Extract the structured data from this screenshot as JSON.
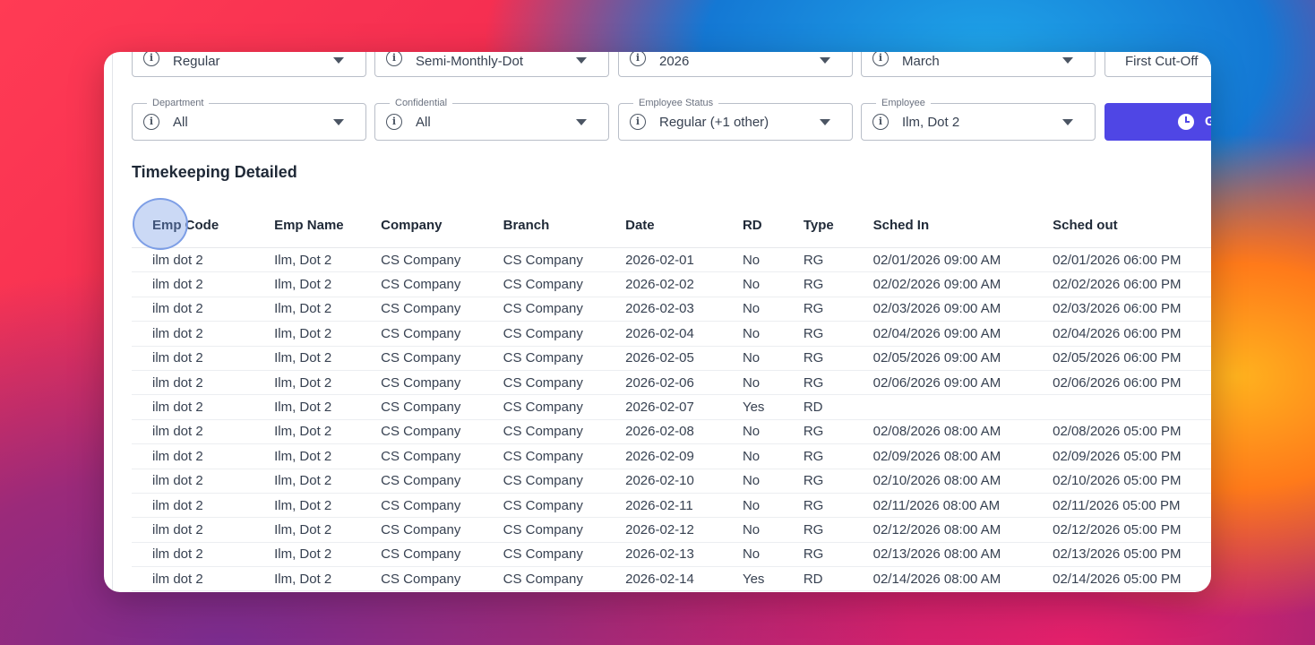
{
  "filters_row1": [
    {
      "value": "Regular"
    },
    {
      "value": "Semi-Monthly-Dot"
    },
    {
      "value": "2026"
    },
    {
      "value": "March"
    },
    {
      "value": "First Cut-Off"
    }
  ],
  "filters_row2": [
    {
      "label": "Department",
      "value": "All"
    },
    {
      "label": "Confidential",
      "value": "All"
    },
    {
      "label": "Employee Status",
      "value": "Regular (+1 other)"
    },
    {
      "label": "Employee",
      "value": "Ilm, Dot 2"
    }
  ],
  "primary_button": {
    "label": "G"
  },
  "section": {
    "title": "Timekeeping Detailed"
  },
  "table": {
    "columns": [
      "Emp Code",
      "Emp Name",
      "Company",
      "Branch",
      "Date",
      "RD",
      "Type",
      "Sched In",
      "Sched out"
    ],
    "rows": [
      [
        "ilm dot 2",
        "Ilm, Dot 2",
        "CS Company",
        "CS Company",
        "2026-02-01",
        "No",
        "RG",
        "02/01/2026 09:00 AM",
        "02/01/2026 06:00 PM"
      ],
      [
        "ilm dot 2",
        "Ilm, Dot 2",
        "CS Company",
        "CS Company",
        "2026-02-02",
        "No",
        "RG",
        "02/02/2026 09:00 AM",
        "02/02/2026 06:00 PM"
      ],
      [
        "ilm dot 2",
        "Ilm, Dot 2",
        "CS Company",
        "CS Company",
        "2026-02-03",
        "No",
        "RG",
        "02/03/2026 09:00 AM",
        "02/03/2026 06:00 PM"
      ],
      [
        "ilm dot 2",
        "Ilm, Dot 2",
        "CS Company",
        "CS Company",
        "2026-02-04",
        "No",
        "RG",
        "02/04/2026 09:00 AM",
        "02/04/2026 06:00 PM"
      ],
      [
        "ilm dot 2",
        "Ilm, Dot 2",
        "CS Company",
        "CS Company",
        "2026-02-05",
        "No",
        "RG",
        "02/05/2026 09:00 AM",
        "02/05/2026 06:00 PM"
      ],
      [
        "ilm dot 2",
        "Ilm, Dot 2",
        "CS Company",
        "CS Company",
        "2026-02-06",
        "No",
        "RG",
        "02/06/2026 09:00 AM",
        "02/06/2026 06:00 PM"
      ],
      [
        "ilm dot 2",
        "Ilm, Dot 2",
        "CS Company",
        "CS Company",
        "2026-02-07",
        "Yes",
        "RD",
        "",
        ""
      ],
      [
        "ilm dot 2",
        "Ilm, Dot 2",
        "CS Company",
        "CS Company",
        "2026-02-08",
        "No",
        "RG",
        "02/08/2026 08:00 AM",
        "02/08/2026 05:00 PM"
      ],
      [
        "ilm dot 2",
        "Ilm, Dot 2",
        "CS Company",
        "CS Company",
        "2026-02-09",
        "No",
        "RG",
        "02/09/2026 08:00 AM",
        "02/09/2026 05:00 PM"
      ],
      [
        "ilm dot 2",
        "Ilm, Dot 2",
        "CS Company",
        "CS Company",
        "2026-02-10",
        "No",
        "RG",
        "02/10/2026 08:00 AM",
        "02/10/2026 05:00 PM"
      ],
      [
        "ilm dot 2",
        "Ilm, Dot 2",
        "CS Company",
        "CS Company",
        "2026-02-11",
        "No",
        "RG",
        "02/11/2026 08:00 AM",
        "02/11/2026 05:00 PM"
      ],
      [
        "ilm dot 2",
        "Ilm, Dot 2",
        "CS Company",
        "CS Company",
        "2026-02-12",
        "No",
        "RG",
        "02/12/2026 08:00 AM",
        "02/12/2026 05:00 PM"
      ],
      [
        "ilm dot 2",
        "Ilm, Dot 2",
        "CS Company",
        "CS Company",
        "2026-02-13",
        "No",
        "RG",
        "02/13/2026 08:00 AM",
        "02/13/2026 05:00 PM"
      ],
      [
        "ilm dot 2",
        "Ilm, Dot 2",
        "CS Company",
        "CS Company",
        "2026-02-14",
        "Yes",
        "RD",
        "02/14/2026 08:00 AM",
        "02/14/2026 05:00 PM"
      ]
    ]
  }
}
